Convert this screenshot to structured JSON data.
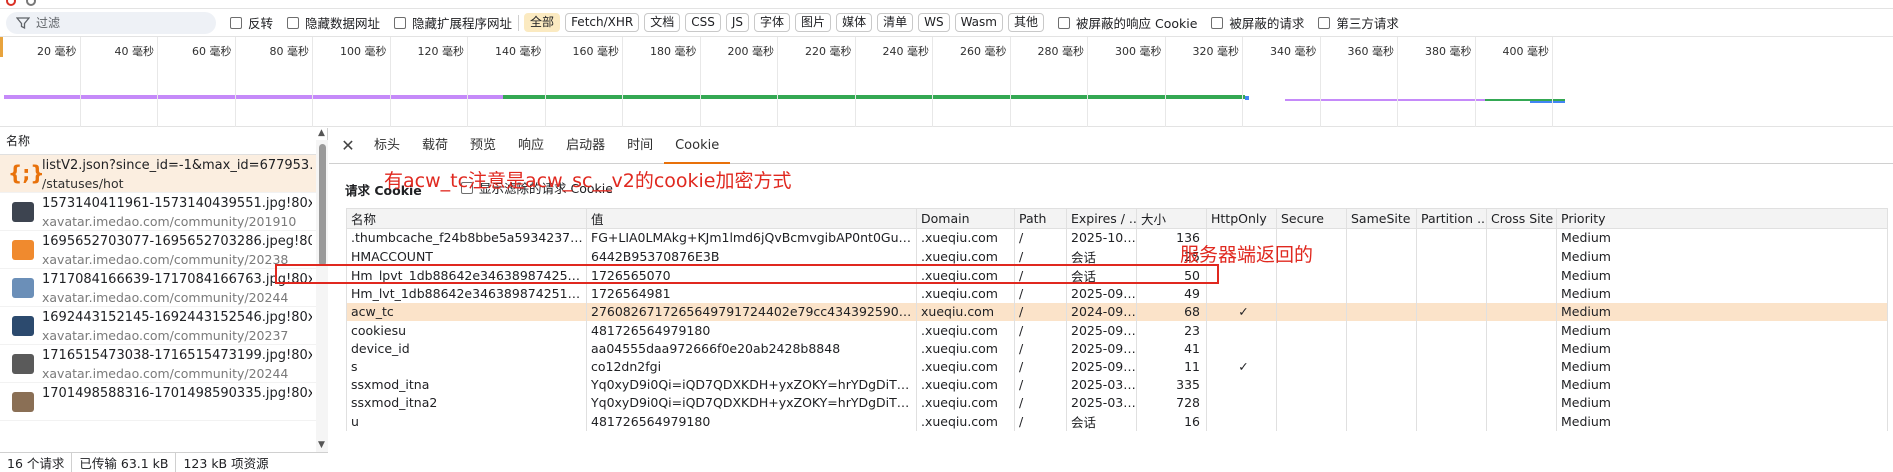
{
  "filter": {
    "placeholder": "过滤",
    "options": [
      "反转",
      "隐藏数据网址",
      "隐藏扩展程序网址"
    ],
    "type_chips": [
      "全部",
      "Fetch/XHR",
      "文档",
      "CSS",
      "JS",
      "字体",
      "图片",
      "媒体",
      "清单",
      "WS",
      "Wasm",
      "其他"
    ],
    "active_chip": "全部",
    "extra_options": [
      "被屏蔽的响应 Cookie",
      "被屏蔽的请求",
      "第三方请求"
    ]
  },
  "timeline": {
    "ticks": [
      "20 毫秒",
      "40 毫秒",
      "60 毫秒",
      "80 毫秒",
      "100 毫秒",
      "120 毫秒",
      "140 毫秒",
      "160 毫秒",
      "180 毫秒",
      "200 毫秒",
      "220 毫秒",
      "240 毫秒",
      "260 毫秒",
      "280 毫秒",
      "300 毫秒",
      "320 毫秒",
      "340 毫秒",
      "360 毫秒",
      "380 毫秒",
      "400 毫秒"
    ],
    "colors": {
      "purple": "#c58af9",
      "green": "#34a853",
      "blue": "#4285f4"
    }
  },
  "request_list": {
    "header": "名称",
    "items": [
      {
        "name": "listV2.json?since_id=-1&max_id=677953...",
        "sub": "/statuses/hot",
        "kind": "json",
        "selected": true
      },
      {
        "name": "1573140411961-1573140439551.jpg!80x...",
        "sub": "xavatar.imedao.com/community/201910",
        "kind": "image",
        "color": "#3d4450"
      },
      {
        "name": "1695652703077-1695652703286.jpeg!80...",
        "sub": "xavatar.imedao.com/community/20238",
        "kind": "image",
        "color": "#f08a2e"
      },
      {
        "name": "1717084166639-1717084166763.jpg!80x...",
        "sub": "xavatar.imedao.com/community/20244",
        "kind": "image",
        "color": "#6b8fb8"
      },
      {
        "name": "1692443152145-1692443152546.jpg!80x...",
        "sub": "xavatar.imedao.com/community/20237",
        "kind": "image",
        "color": "#2c4a6e"
      },
      {
        "name": "1716515473038-1716515473199.jpg!80x...",
        "sub": "xavatar.imedao.com/community/20244",
        "kind": "image",
        "color": "#5a5a5a"
      },
      {
        "name": "1701498588316-1701498590335.jpg!80x...",
        "sub": "",
        "kind": "image",
        "color": "#8a6f55"
      }
    ]
  },
  "status": {
    "requests": "16 个请求",
    "transferred": "已传输 63.1 kB",
    "resources": "123 kB 项资源"
  },
  "detail_tabs": [
    "标头",
    "载荷",
    "预览",
    "响应",
    "启动器",
    "时间",
    "Cookie"
  ],
  "active_tab": "Cookie",
  "cookies": {
    "section_title": "请求 Cookie",
    "show_filtered_label": "显示滤除的请求 Cookie",
    "columns": [
      "名称",
      "值",
      "Domain",
      "Path",
      "Expires / ...",
      "大小",
      "HttpOnly",
      "Secure",
      "SameSite",
      "Partition ...",
      "Cross Site",
      "Priority"
    ],
    "rows": [
      [
        ".thumbcache_f24b8bbe5a5934237bbc0ed...",
        "FG+LIA0LMAkg+KJm1lmd6jQvBcmvgibAP0nt0GuAFI8qK5y...",
        ".xueqiu.com",
        "/",
        "2025-10-...",
        "136",
        "",
        "",
        "",
        "",
        "",
        "Medium"
      ],
      [
        "HMACCOUNT",
        "6442B95370876E3B",
        ".xueqiu.com",
        "/",
        "会话",
        "25",
        "",
        "",
        "",
        "",
        "",
        "Medium"
      ],
      [
        "Hm_lpvt_1db88642e346389874251b5a1ed...",
        "1726565070",
        ".xueqiu.com",
        "/",
        "会话",
        "50",
        "",
        "",
        "",
        "",
        "",
        "Medium"
      ],
      [
        "Hm_lvt_1db88642e346389874251b5a1ede...",
        "1726564981",
        ".xueqiu.com",
        "/",
        "2025-09-...",
        "49",
        "",
        "",
        "",
        "",
        "",
        "Medium"
      ],
      [
        "acw_tc",
        "2760826717265649791724402e79cc43439259046533a3ab9...",
        "xueqiu.com",
        "/",
        "2024-09-...",
        "68",
        "✓",
        "",
        "",
        "",
        "",
        "Medium"
      ],
      [
        "cookiesu",
        "481726564979180",
        ".xueqiu.com",
        "/",
        "2025-09-...",
        "23",
        "",
        "",
        "",
        "",
        "",
        "Medium"
      ],
      [
        "device_id",
        "aa04555daa972666f0e20ab2428b8848",
        ".xueqiu.com",
        "/",
        "2025-09-...",
        "41",
        "",
        "",
        "",
        "",
        "",
        "Medium"
      ],
      [
        "s",
        "co12dn2fgi",
        ".xueqiu.com",
        "/",
        "2025-09-...",
        "11",
        "✓",
        "",
        "",
        "",
        "",
        "Medium"
      ],
      [
        "ssxmod_itna",
        "Yq0xyD9i0Qi=iQD7QDXKDH+yxZOKY=hrYDgDiTn+P85DsN...",
        ".xueqiu.com",
        "/",
        "2025-03-...",
        "335",
        "",
        "",
        "",
        "",
        "",
        "Medium"
      ],
      [
        "ssxmod_itna2",
        "Yq0xyD9i0Qi=iQD7QDXKDH+yxZOKY=hrYDgDiTn+P3ik6dp...",
        ".xueqiu.com",
        "/",
        "2025-03-...",
        "728",
        "",
        "",
        "",
        "",
        "",
        "Medium"
      ],
      [
        "u",
        "481726564979180",
        ".xueqiu.com",
        "/",
        "会话",
        "16",
        "",
        "",
        "",
        "",
        "",
        "Medium"
      ]
    ],
    "highlight_row": 4
  },
  "annotations": {
    "top": "有acw_tc注意是acw_sc__v2的cookie加密方式",
    "right": "服务器端返回的",
    "color": "#e0281f"
  }
}
